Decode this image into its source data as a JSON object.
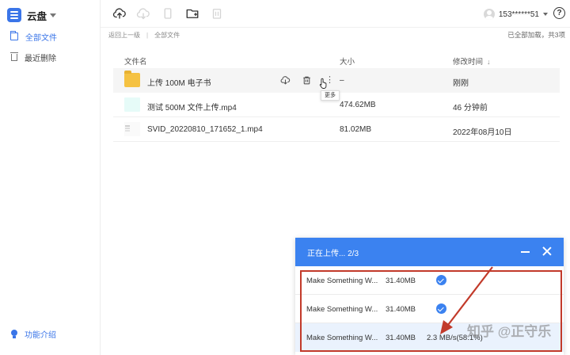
{
  "app": {
    "name": "云盘"
  },
  "sidebar": {
    "items": [
      {
        "label": "全部文件"
      },
      {
        "label": "最近删除"
      }
    ],
    "intro_label": "功能介绍"
  },
  "user": {
    "account": "153******51"
  },
  "help_glyph": "?",
  "breadcrumb": {
    "back": "返回上一级",
    "sep": "|",
    "current": "全部文件"
  },
  "status": "已全部加载，共3项",
  "table": {
    "headers": {
      "name": "文件名",
      "size": "大小",
      "time": "修改时间"
    },
    "sort_glyph": "↓",
    "rows": [
      {
        "name": "上传 100M 电子书",
        "size": "–",
        "time": "刚刚",
        "type": "folder"
      },
      {
        "name": "测试 500M 文件上传.mp4",
        "size": "474.62MB",
        "time": "46 分钟前",
        "type": "video"
      },
      {
        "name": "SVID_20220810_171652_1.mp4",
        "size": "81.02MB",
        "time": "2022年08月10日",
        "type": "doc"
      }
    ],
    "more_glyph": "⋮",
    "tooltip": "更多"
  },
  "upload": {
    "title": "正在上传... 2/3",
    "items": [
      {
        "name": "Make Something W...",
        "size": "31.40MB",
        "state": "done"
      },
      {
        "name": "Make Something W...",
        "size": "31.40MB",
        "state": "done"
      },
      {
        "name": "Make Something W...",
        "size": "31.40MB",
        "state": "uploading",
        "progress": "2.3 MB/s(58.1%)"
      }
    ]
  },
  "watermark": "知乎 @正守乐",
  "colors": {
    "accent": "#3a75e8",
    "upload_header": "#3b82f0",
    "annotation": "#c23a2a",
    "folder": "#f5c242"
  },
  "icons": {
    "toolbar": [
      "upload-cloud-icon",
      "download-cloud-icon",
      "copy-icon",
      "new-folder-icon",
      "delete-icon"
    ],
    "row_actions": [
      "download-icon",
      "trash-icon",
      "more-icon"
    ]
  }
}
